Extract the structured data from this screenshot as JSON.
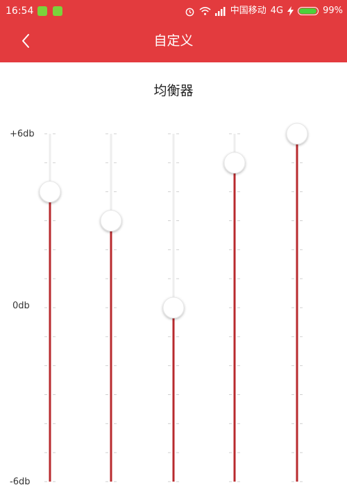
{
  "status_bar": {
    "time": "16:54",
    "carrier": "中国移动",
    "network": "4G",
    "battery": "99%",
    "battery_level": 0.99,
    "icons": [
      "alarm-icon",
      "wifi-icon",
      "signal-icon",
      "charging-icon"
    ]
  },
  "header": {
    "title": "自定义",
    "back_icon": "chevron-left-icon",
    "color": "#e33b3e"
  },
  "equalizer": {
    "title": "均衡器",
    "scale_labels": {
      "max": "+6db",
      "mid": "0db",
      "min": "-6db"
    },
    "range_db": [
      -6,
      6
    ],
    "band_levels_db": [
      4,
      3,
      0,
      5,
      6
    ],
    "track_color": "#eeeeee",
    "fill_color": "#b82a2e"
  }
}
